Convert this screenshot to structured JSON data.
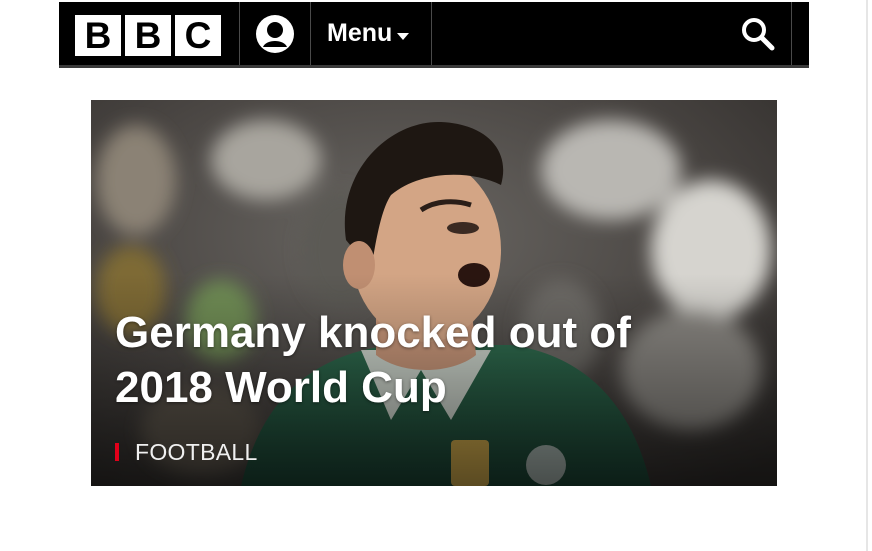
{
  "header": {
    "logo_letters": [
      "B",
      "B",
      "C"
    ],
    "account_icon": "account-icon",
    "menu_label": "Menu",
    "menu_icon": "chevron-down-icon",
    "search_icon": "search-icon",
    "colors": {
      "background": "#000000",
      "text": "#ffffff"
    }
  },
  "promo": {
    "headline": "Germany knocked out of 2018 World Cup",
    "section_tag": "FOOTBALL",
    "tag_color": "#e2001a"
  }
}
